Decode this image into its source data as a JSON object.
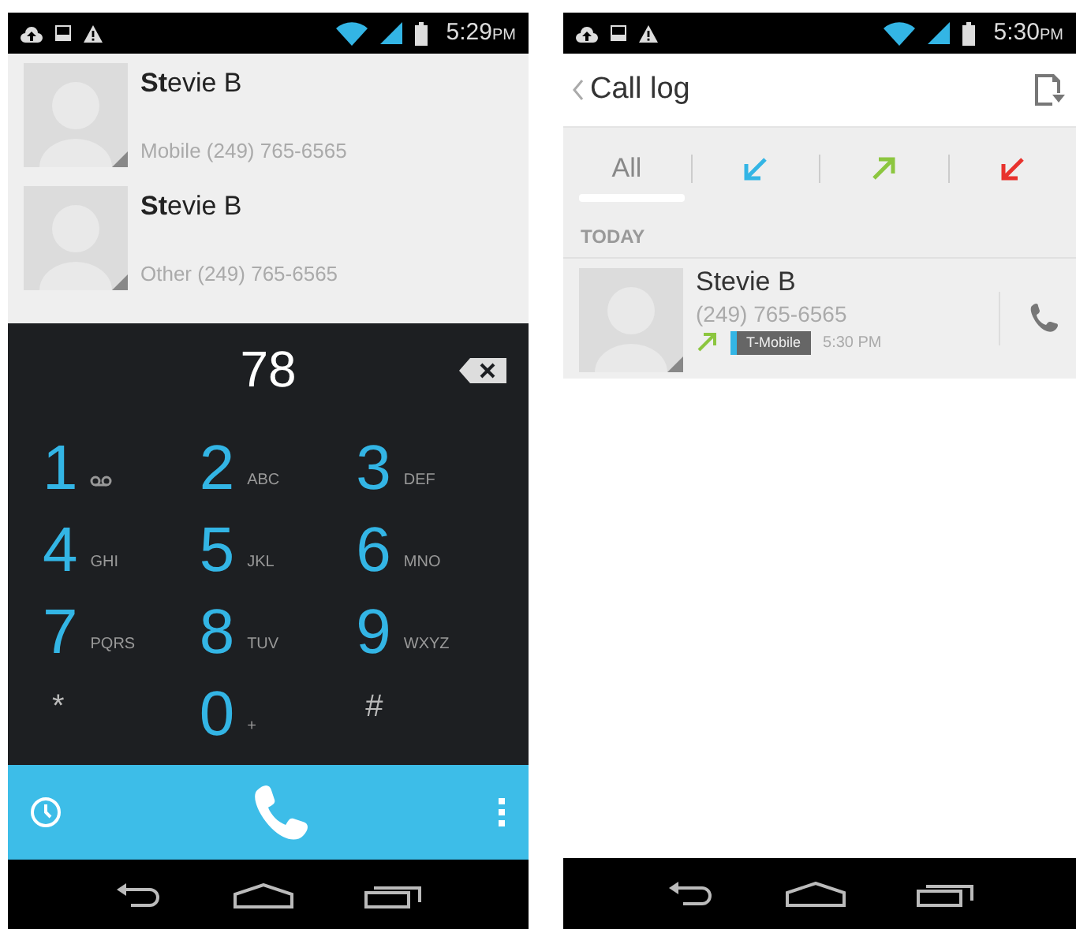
{
  "dialer_screen": {
    "status_bar": {
      "time": "5:29",
      "ampm": "PM"
    },
    "contacts": [
      {
        "name": "**St**evie B",
        "detail": "Mobile (249) 765-6565"
      },
      {
        "name": "**St**evie B",
        "detail": "Other (249) 765-6565"
      }
    ],
    "dialer": {
      "digits": "78",
      "keys": [
        {
          "kind": "voicemail",
          "digit": "1"
        },
        {
          "kind": "digit",
          "digit": "2",
          "letters": "ABC"
        },
        {
          "kind": "digit",
          "digit": "3",
          "letters": "DEF"
        },
        {
          "kind": "digit",
          "digit": "4",
          "letters": "GHI"
        },
        {
          "kind": "digit",
          "digit": "5",
          "letters": "JKL"
        },
        {
          "kind": "digit",
          "digit": "6",
          "letters": "MNO"
        },
        {
          "kind": "digit",
          "digit": "7",
          "letters": "PQRS"
        },
        {
          "kind": "digit",
          "digit": "8",
          "letters": "TUV"
        },
        {
          "kind": "digit",
          "digit": "9",
          "letters": "WXYZ"
        },
        {
          "kind": "symbol",
          "digit": "*"
        },
        {
          "kind": "digit",
          "digit": "0",
          "letters": "+"
        },
        {
          "kind": "symbol",
          "digit": "#"
        }
      ]
    }
  },
  "call_log_screen": {
    "status_bar": {
      "time": "5:30",
      "ampm": "PM"
    },
    "title": "Call log",
    "tabs": [
      {
        "kind": "text",
        "label": "All",
        "selected": true
      },
      {
        "kind": "incoming",
        "color": "#33b5e5",
        "selected": false
      },
      {
        "kind": "outgoing",
        "color": "#8cc63f",
        "selected": false
      },
      {
        "kind": "missed",
        "color": "#e8322d",
        "selected": false
      }
    ],
    "section": "TODAY",
    "entries": [
      {
        "name": "Stevie B",
        "number": "(249) 765-6565",
        "kind": "outgoing",
        "carrier": "T-Mobile",
        "time": "5:30 PM"
      }
    ]
  }
}
